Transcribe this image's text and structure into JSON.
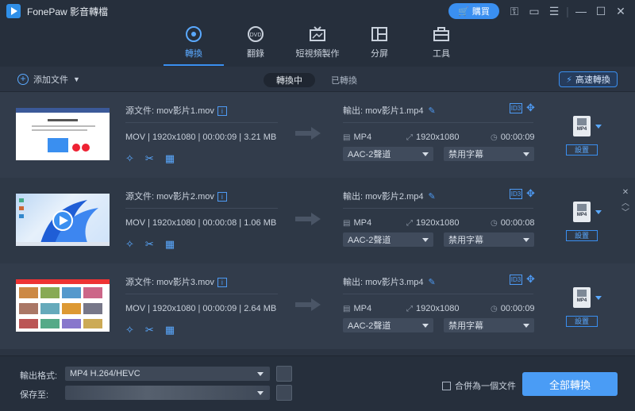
{
  "app": {
    "title": "FonePaw 影音轉檔",
    "buy_label": "購買"
  },
  "nav": {
    "tabs": [
      {
        "label": "轉換",
        "icon": "convert-icon"
      },
      {
        "label": "翻錄",
        "icon": "dvd-icon"
      },
      {
        "label": "短視頻製作",
        "icon": "mv-icon"
      },
      {
        "label": "分屏",
        "icon": "collage-icon"
      },
      {
        "label": "工具",
        "icon": "toolbox-icon"
      }
    ],
    "active": "轉換"
  },
  "toolbar": {
    "add_file": "添加文件",
    "seg_converting": "轉換中",
    "seg_converted": "已轉換",
    "fast_convert": "高速轉換"
  },
  "files": [
    {
      "source": "源文件: mov影片1.mov",
      "meta": "MOV | 1920x1080 | 00:00:09 | 3.21 MB",
      "output": "輸出: mov影片1.mp4",
      "out_format": "MP4",
      "out_res": "1920x1080",
      "out_dur": "00:00:09",
      "audio": "AAC-2聲道",
      "subtitle": "禁用字幕",
      "settings": "設置",
      "fmt_badge": "MP4"
    },
    {
      "source": "源文件: mov影片2.mov",
      "meta": "MOV | 1920x1080 | 00:00:08 | 1.06 MB",
      "output": "輸出: mov影片2.mp4",
      "out_format": "MP4",
      "out_res": "1920x1080",
      "out_dur": "00:00:08",
      "audio": "AAC-2聲道",
      "subtitle": "禁用字幕",
      "settings": "設置",
      "fmt_badge": "MP4"
    },
    {
      "source": "源文件: mov影片3.mov",
      "meta": "MOV | 1920x1080 | 00:00:09 | 2.64 MB",
      "output": "輸出: mov影片3.mp4",
      "out_format": "MP4",
      "out_res": "1920x1080",
      "out_dur": "00:00:09",
      "audio": "AAC-2聲道",
      "subtitle": "禁用字幕",
      "settings": "設置",
      "fmt_badge": "MP4"
    }
  ],
  "bottom": {
    "output_format_label": "輸出格式:",
    "output_format_value": "MP4 H.264/HEVC",
    "save_to_label": "保存至:",
    "merge_label": "合併為一個文件",
    "convert_all": "全部轉換"
  }
}
